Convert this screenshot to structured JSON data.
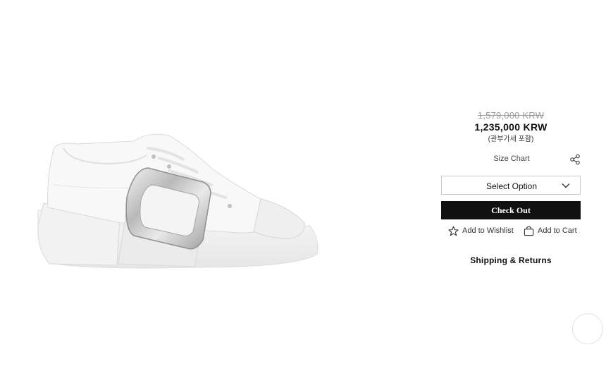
{
  "product": {
    "image_alt": "White leather sneaker with silver buckle",
    "price_original": "1,579,000 KRW",
    "price_current": "1,235,000 KRW",
    "price_tax_note": "(관부가세 포함)"
  },
  "actions": {
    "size_chart_label": "Size Chart",
    "share_icon": "share-icon",
    "select_option_label": "Select Option",
    "checkout_label": "Check Out",
    "wishlist_label": "Add to Wishlist",
    "wishlist_icon": "star-icon",
    "cart_label": "Add to Cart",
    "cart_icon": "bag-icon",
    "shipping_label": "Shipping & Returns"
  },
  "colors": {
    "checkout_bg": "#111111",
    "strike_price": "#9a9a9a",
    "border": "#c9c9c9"
  }
}
